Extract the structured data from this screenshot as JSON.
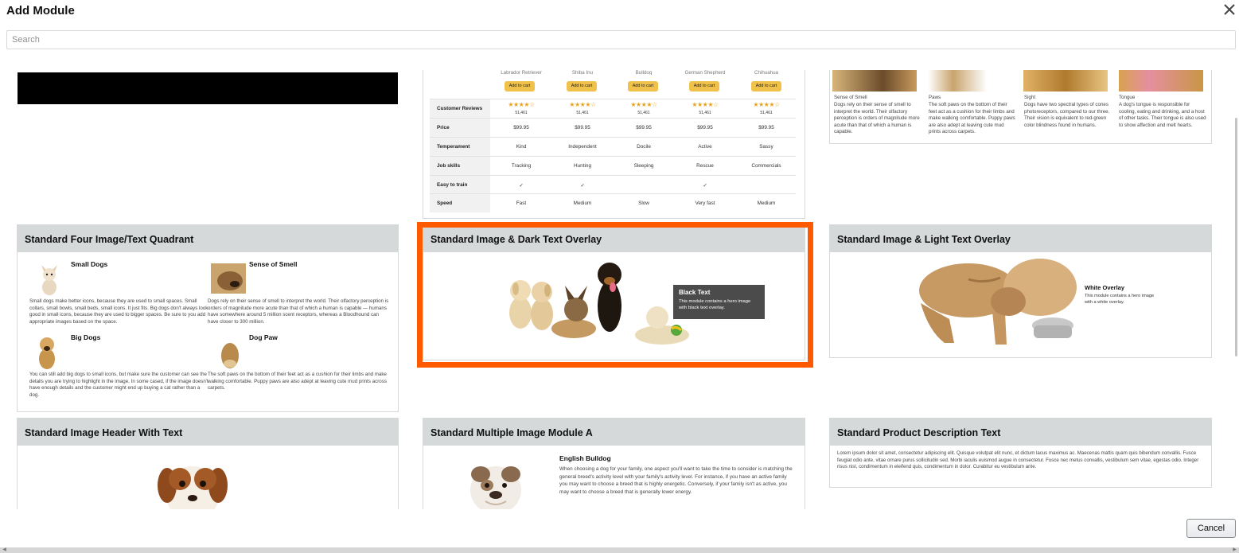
{
  "dialog": {
    "title": "Add Module",
    "close_glyph": "✕",
    "cancel_label": "Cancel"
  },
  "search": {
    "placeholder": "Search",
    "value": ""
  },
  "comparison": {
    "products": [
      "Labrador Retriever",
      "Shiba Inu",
      "Bulldog",
      "German Shepherd",
      "Chihuahua"
    ],
    "add_to_cart": "Add to cart",
    "rows": [
      {
        "label": "Customer Reviews",
        "cells": [
          "★★★★☆",
          "★★★★☆",
          "★★★★☆",
          "★★★★☆",
          "★★★★☆"
        ],
        "sub": "51,461"
      },
      {
        "label": "Price",
        "cells": [
          "$99.95",
          "$99.95",
          "$99.95",
          "$99.95",
          "$99.95"
        ]
      },
      {
        "label": "Temperament",
        "cells": [
          "Kind",
          "Independent",
          "Docile",
          "Active",
          "Sassy"
        ]
      },
      {
        "label": "Job skills",
        "cells": [
          "Tracking",
          "Hunting",
          "Sleeping",
          "Rescue",
          "Commercials"
        ]
      },
      {
        "label": "Easy to train",
        "cells": [
          "✓",
          "✓",
          "",
          "✓",
          ""
        ]
      },
      {
        "label": "Speed",
        "cells": [
          "Fast",
          "Medium",
          "Slow",
          "Very fast",
          "Medium"
        ]
      }
    ]
  },
  "four_columns": [
    {
      "title": "Sense of Smell",
      "text": "Dogs rely on their sense of smell to interpret the world. Their olfactory perception is orders of magnitude more acute than that of which a human is capable."
    },
    {
      "title": "Paws",
      "text": "The soft paws on the bottom of their feet act as a cushion for their limbs and make walking comfortable. Puppy paws are also adept at leaving cute mud prints across carpets."
    },
    {
      "title": "Sight",
      "text": "Dogs have two spectral types of cones photoreceptors, compared to our three. Their vision is equivalent to red-green color blindness found in humans."
    },
    {
      "title": "Tongue",
      "text": "A dog's tongue is responsible for cooling, eating and drinking, and a host of other tasks. Their tongue is also used to show affection and melt hearts."
    }
  ],
  "cards": {
    "quadrant": {
      "title": "Standard Four Image/Text Quadrant",
      "items": [
        {
          "title": "Small Dogs",
          "text": "Small dogs make better icons, because they are used to small spaces. Small collars, small bowls, small beds, small icons. It just fits. Big dogs don't always look good in small icons, because they are used to bigger spaces. Be sure to you add appropriate images based on the space."
        },
        {
          "title": "Sense of Smell",
          "text": "Dogs rely on their sense of smell to interpret the world. Their olfactory perception is orders of magnitude more acute than that of which a human is capable — humans have somewhere around 5 million scent receptors, whereas a Bloodhound can have closer to 300 million."
        },
        {
          "title": "Big Dogs",
          "text": "You can still add big dogs to small icons, but make sure the customer can see the details you are trying to highlight in the image. In some cased, if the image doesn't have enough details and the customer might end up buying a cat rather than a dog."
        },
        {
          "title": "Dog Paw",
          "text": "The soft paws on the bottom of their feet act as a cushion for their limbs and make walking comfortable. Puppy paws are also adept at leaving cute mud prints across carpets."
        }
      ]
    },
    "dark_overlay": {
      "title": "Standard Image & Dark Text Overlay",
      "overlay_title": "Black Text",
      "overlay_text": "This module contains a hero image with black text overlay."
    },
    "light_overlay": {
      "title": "Standard Image & Light Text Overlay",
      "overlay_title": "White Overlay",
      "overlay_text": "This module contains a hero image with a white overlay."
    },
    "header_text": {
      "title": "Standard Image Header With Text"
    },
    "multi_image": {
      "title": "Standard Multiple Image Module A",
      "heading": "English Bulldog",
      "text": "When choosing a dog for your family, one aspect you'll want to take the time to consider is matching the general breed's activity level with your family's activity level. For instance, if you have an active family you may want to choose a breed that is highly energetic. Conversely, if your family isn't as active, you may want to choose a breed that is generally lower energy."
    },
    "product_desc": {
      "title": "Standard Product Description Text",
      "text": "Lorem ipsum dolor sit amet, consectetur adipiscing elit. Quisque volutpat elit nunc, et dictum lacus maximus ac. Maecenas mattis quam quis bibendum convallis. Fusce feugiat odio ante, vitae ornare purus sollicitudin sed. Morbi iaculis euismod augue in consectetur. Fusce nec metus convallis, vestibulum sem vitae, egestas odio. Integer risus nisl, condimentum in eleifend quis, condimentum in dolor. Curabitur eu vestibulum ante."
    }
  },
  "colors": {
    "selection": "#ff5a00",
    "card_header": "#d5d9d9",
    "cart_button": "#f0c14b",
    "stars": "#e7a21b"
  }
}
